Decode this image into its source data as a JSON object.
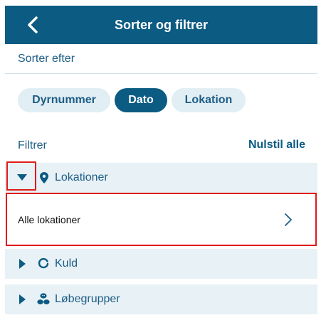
{
  "header": {
    "title": "Sorter og filtrer"
  },
  "sort": {
    "label": "Sorter efter",
    "chips": [
      {
        "label": "Dyrnummer",
        "selected": false
      },
      {
        "label": "Dato",
        "selected": true
      },
      {
        "label": "Lokation",
        "selected": false
      }
    ]
  },
  "filter": {
    "label": "Filtrer",
    "reset_label": "Nulstil alle",
    "groups": [
      {
        "label": "Lokationer",
        "expanded": true,
        "icon": "location-pin-icon"
      },
      {
        "label": "Kuld",
        "expanded": false,
        "icon": "ring-icon"
      },
      {
        "label": "Løbegrupper",
        "expanded": false,
        "icon": "animals-group-icon"
      }
    ],
    "location_option": {
      "label": "Alle lokationer"
    }
  },
  "colors": {
    "primary": "#0b5b82",
    "chip_inactive_bg": "#e1eef4",
    "row_bg": "#e8f1f6",
    "text_blue": "#1d5d85",
    "highlight": "#e01a1a"
  }
}
